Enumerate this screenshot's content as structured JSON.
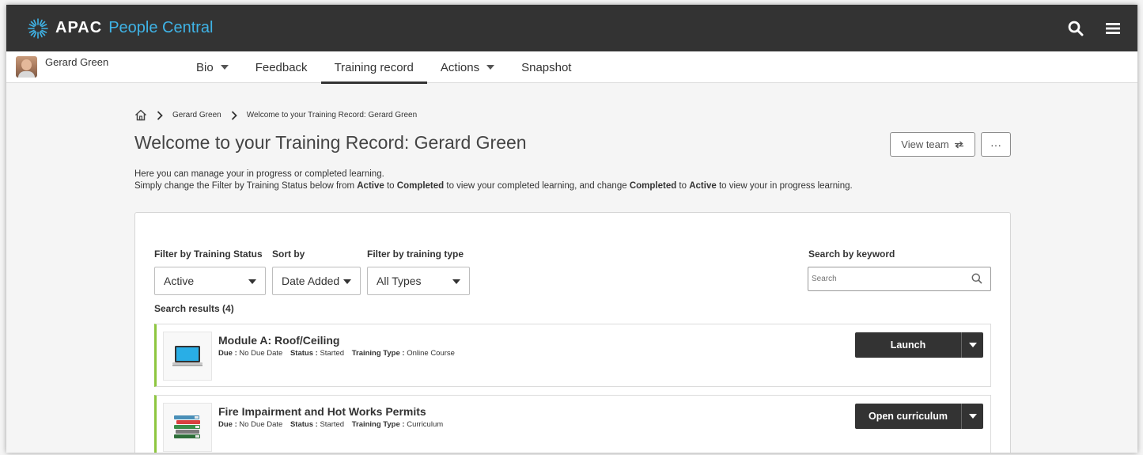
{
  "header": {
    "logo_text": "APAC",
    "logo_subtitle": "People Central",
    "colors": {
      "bar": "#333333",
      "brand": "#3fb3e6"
    }
  },
  "user": {
    "name": "Gerard Green"
  },
  "tabs": [
    {
      "label": "Bio",
      "has_dropdown": true
    },
    {
      "label": "Feedback",
      "has_dropdown": false
    },
    {
      "label": "Training record",
      "active": true
    },
    {
      "label": "Actions",
      "has_dropdown": true
    },
    {
      "label": "Snapshot",
      "has_dropdown": false
    }
  ],
  "breadcrumb": {
    "items": [
      "Gerard Green",
      "Welcome to your Training Record: Gerard Green"
    ]
  },
  "page": {
    "title": "Welcome to your Training Record: Gerard Green",
    "view_team_label": "View team",
    "more_label": "···",
    "intro_line1": "Here you can manage your in progress or completed learning.",
    "intro_line2_a": "Simply change the Filter by Training Status below from ",
    "intro_line2_b": "Active",
    "intro_line2_c": " to ",
    "intro_line2_d": "Completed",
    "intro_line2_e": " to view your completed learning, and change ",
    "intro_line2_f": "Completed",
    "intro_line2_g": " to ",
    "intro_line2_h": "Active",
    "intro_line2_i": " to view your in progress learning."
  },
  "filters": {
    "status_label": "Filter by Training Status",
    "status_value": "Active",
    "sort_label": "Sort by",
    "sort_value": "Date Added",
    "type_label": "Filter by training type",
    "type_value": "All Types",
    "keyword_label": "Search by keyword",
    "search_placeholder": "Search"
  },
  "results": {
    "label": "Search results (4)",
    "items": [
      {
        "title": "Module A: Roof/Ceiling",
        "due_label": "Due :",
        "due_value": "No Due Date",
        "status_label": "Status :",
        "status_value": "Started",
        "type_label": "Training Type :",
        "type_value": "Online Course",
        "action_label": "Launch",
        "icon": "laptop-icon"
      },
      {
        "title": "Fire Impairment and Hot Works Permits",
        "due_label": "Due :",
        "due_value": "No Due Date",
        "status_label": "Status :",
        "status_value": "Started",
        "type_label": "Training Type :",
        "type_value": "Curriculum",
        "action_label": "Open curriculum",
        "icon": "books-icon"
      }
    ],
    "accent_color": "#8dc63f"
  }
}
